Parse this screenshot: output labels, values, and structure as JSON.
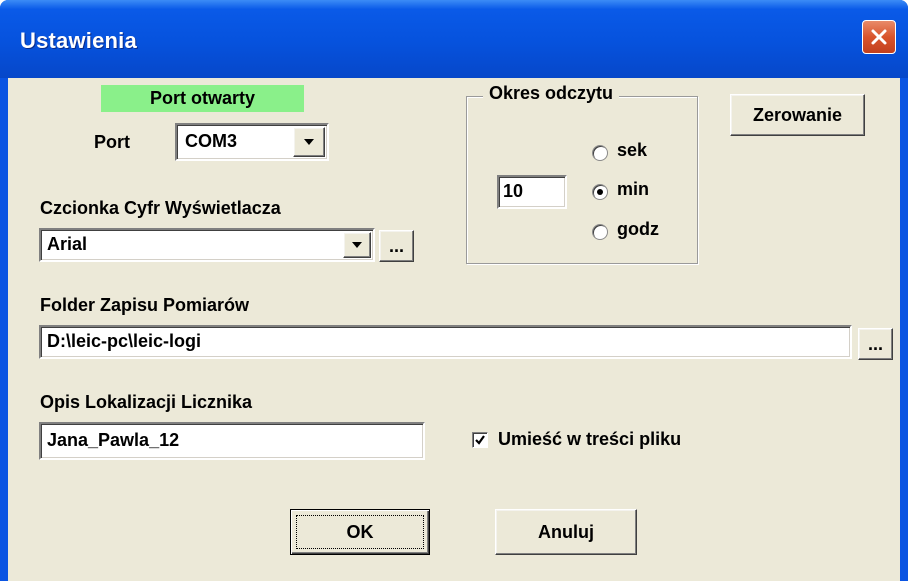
{
  "window": {
    "title": "Ustawienia"
  },
  "port": {
    "status": "Port otwarty",
    "status_color": "#8af08a",
    "label": "Port",
    "selected": "COM3"
  },
  "font": {
    "label": "Czcionka Cyfr Wyświetlacza",
    "selected": "Arial",
    "browse_label": "..."
  },
  "period": {
    "group_label": "Okres odczytu",
    "value": "10",
    "options": [
      {
        "label": "sek",
        "checked": false
      },
      {
        "label": "min",
        "checked": true
      },
      {
        "label": "godz",
        "checked": false
      }
    ]
  },
  "reset_button": "Zerowanie",
  "folder": {
    "label": "Folder Zapisu Pomiarów",
    "value": "D:\\leic-pc\\leic-logi",
    "browse_label": "..."
  },
  "location": {
    "label": "Opis Lokalizacji Licznika",
    "value": "Jana_Pawla_12"
  },
  "include_in_file": {
    "label": "Umieść w treści pliku",
    "checked": true
  },
  "ok_button": "OK",
  "cancel_button": "Anuluj",
  "icons": {
    "close": "close-icon",
    "dropdown": "chevron-down-icon",
    "check": "check-icon"
  }
}
